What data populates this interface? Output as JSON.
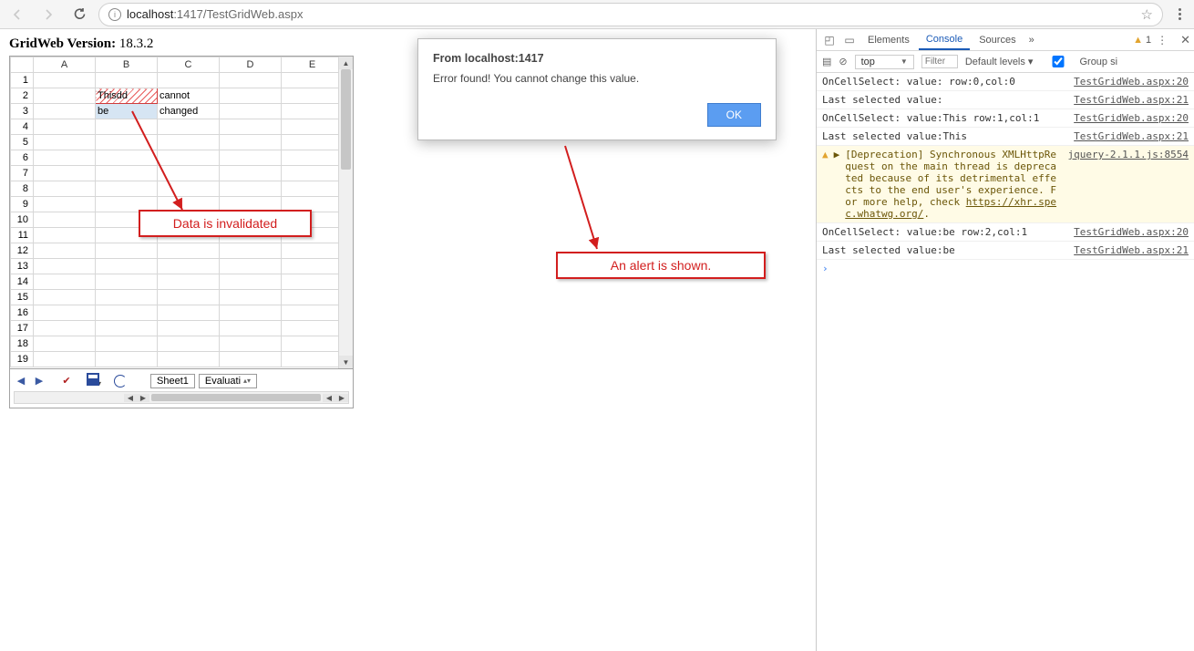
{
  "browser": {
    "url": "localhost:1417/TestGridWeb.aspx",
    "url_host": "localhost",
    "url_port": ":1417",
    "url_path": "/TestGridWeb.aspx"
  },
  "page": {
    "version_label": "GridWeb Version:",
    "version_value": "18.3.2"
  },
  "grid": {
    "columns": [
      "A",
      "B",
      "C",
      "D",
      "E"
    ],
    "rows": [
      "1",
      "2",
      "3",
      "4",
      "5",
      "6",
      "7",
      "8",
      "9",
      "10",
      "11",
      "12",
      "13",
      "14",
      "15",
      "16",
      "17",
      "18",
      "19"
    ],
    "cells": {
      "B2": "Thisdd",
      "C2": "cannot",
      "B3": "be",
      "C3": "changed"
    },
    "invalid_cell": "B2",
    "selected_cell": "B3",
    "sheet_tabs": [
      "Sheet1",
      "Evaluati"
    ]
  },
  "alert": {
    "title": "From localhost:1417",
    "message": "Error found! You cannot change this value.",
    "ok_label": "OK"
  },
  "callouts": {
    "data_invalidated": "Data is invalidated",
    "alert_shown": "An alert is shown."
  },
  "devtools": {
    "tabs": [
      "Elements",
      "Console",
      "Sources"
    ],
    "active_tab": "Console",
    "more": "»",
    "warning_count": "1",
    "context_selector": "top",
    "filter_placeholder": "Filter",
    "levels_label": "Default levels ▾",
    "group_label": "Group si",
    "logs": [
      {
        "type": "log",
        "msg": "OnCellSelect: value: row:0,col:0",
        "src": "TestGridWeb.aspx:20"
      },
      {
        "type": "log",
        "msg": "Last selected value:",
        "src": "TestGridWeb.aspx:21"
      },
      {
        "type": "log",
        "msg": "OnCellSelect: value:This row:1,col:1",
        "src": "TestGridWeb.aspx:20"
      },
      {
        "type": "log",
        "msg": "Last selected value:This",
        "src": "TestGridWeb.aspx:21"
      },
      {
        "type": "warn",
        "msg_prefix": "[Deprecation] Synchronous XMLHttpRequest on the main thread is deprecated because of its detrimental effects to the end user's experience. For more help, check ",
        "link": "https://xhr.spec.whatwg.org/",
        "msg_suffix": ".",
        "src": "jquery-2.1.1.js:8554"
      },
      {
        "type": "log",
        "msg": "OnCellSelect: value:be row:2,col:1",
        "src": "TestGridWeb.aspx:20"
      },
      {
        "type": "log",
        "msg": "Last selected value:be",
        "src": "TestGridWeb.aspx:21"
      }
    ]
  }
}
